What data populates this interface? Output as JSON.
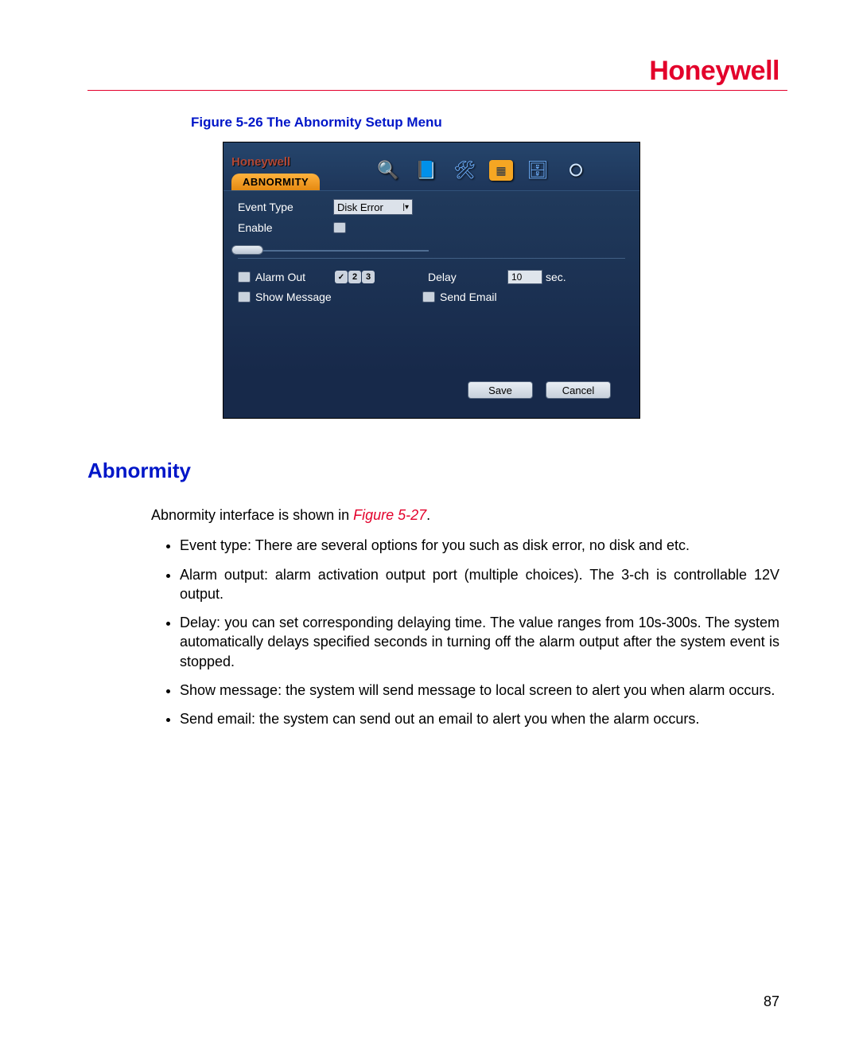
{
  "brand": "Honeywell",
  "figure_caption": "Figure 5-26 The Abnormity Setup Menu",
  "dvr": {
    "brand": "Honeywell",
    "tab": "ABNORMITY",
    "event_type_label": "Event Type",
    "event_type_value": "Disk Error",
    "enable_label": "Enable",
    "alarm_out_label": "Alarm Out",
    "alarm_out_options": [
      "1",
      "2",
      "3"
    ],
    "delay_label": "Delay",
    "delay_value": "10",
    "delay_unit": "sec.",
    "show_message_label": "Show Message",
    "send_email_label": "Send Email",
    "save": "Save",
    "cancel": "Cancel"
  },
  "section_heading": "Abnormity",
  "intro_prefix": "Abnormity interface is shown in ",
  "intro_figref": "Figure 5-27",
  "intro_suffix": ".",
  "bullets": [
    "Event type: There are several options for you such as disk error, no disk and etc.",
    "Alarm output: alarm activation output port (multiple choices). The 3-ch is controllable 12V output.",
    "Delay: you can set corresponding delaying time. The value ranges from 10s-300s. The system automatically delays specified seconds in turning off the alarm output after the system event is stopped.",
    "Show message: the system will send message to local screen to alert you when alarm occurs.",
    "Send email: the system can send out an email to alert you when the alarm occurs."
  ],
  "page_number": "87"
}
